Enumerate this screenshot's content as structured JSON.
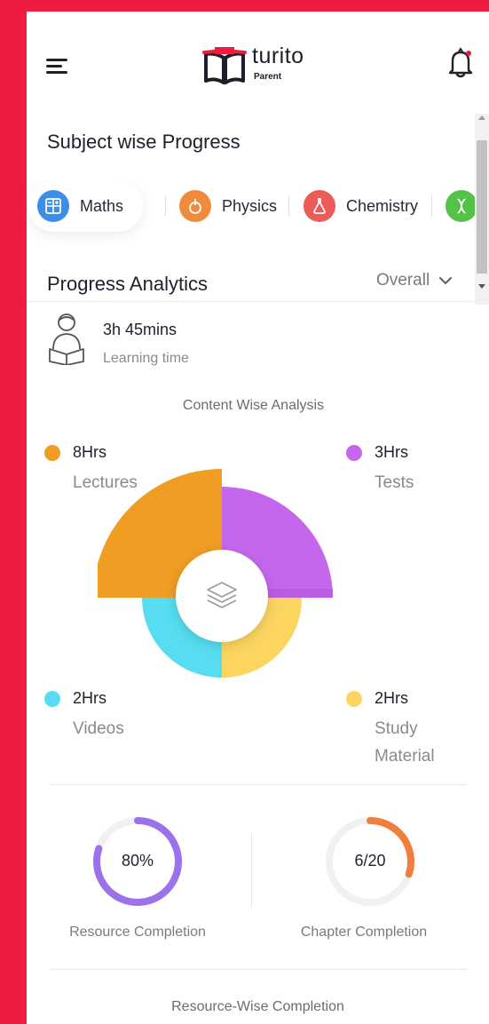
{
  "header": {
    "logo_text": "turito",
    "logo_sub": "Parent"
  },
  "subject_progress": {
    "title": "Subject wise Progress",
    "subjects": [
      {
        "label": "Maths",
        "icon": "calculator-icon",
        "color": "#3d8ee8",
        "active": true
      },
      {
        "label": "Physics",
        "icon": "atom-icon",
        "color": "#f08a3c",
        "active": false
      },
      {
        "label": "Chemistry",
        "icon": "flask-icon",
        "color": "#ec5a5a",
        "active": false
      },
      {
        "label": "",
        "icon": "dna-icon",
        "color": "#53c246",
        "active": false
      }
    ]
  },
  "analytics": {
    "title": "Progress Analytics",
    "filter_value": "Overall",
    "learning_time_value": "3h 45mins",
    "learning_time_label": "Learning time",
    "content_title": "Content Wise Analysis",
    "legend": {
      "lectures": {
        "value": "8Hrs",
        "label": "Lectures",
        "color": "#f09d24"
      },
      "tests": {
        "value": "3Hrs",
        "label": "Tests",
        "color": "#c567ec"
      },
      "videos": {
        "value": "2Hrs",
        "label": "Videos",
        "color": "#56ddf1"
      },
      "study": {
        "value": "2Hrs",
        "label_line1": "Study",
        "label_line2": "Material",
        "color": "#fbd560"
      }
    }
  },
  "completion": {
    "resource": {
      "value": "80%",
      "label": "Resource Completion",
      "fraction": 0.8,
      "color": "#9b72ec"
    },
    "chapter": {
      "value": "6/20",
      "label": "Chapter Completion",
      "fraction": 0.3,
      "color": "#f07f3c"
    },
    "resource_wise_title": "Resource-Wise Completion"
  }
}
